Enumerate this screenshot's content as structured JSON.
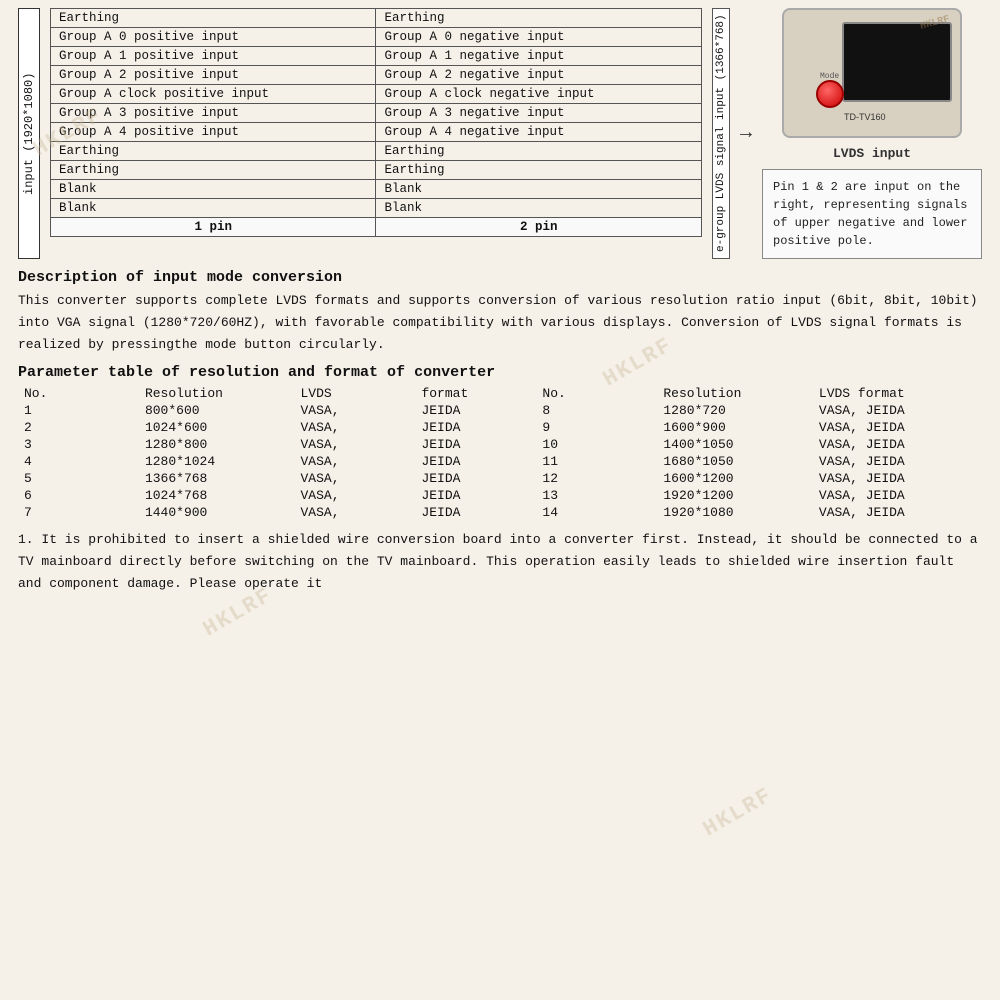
{
  "watermarks": [
    "HKLRF",
    "HKLRF",
    "HKLRF",
    "HKLRF"
  ],
  "left_label": "input (1920*1080)",
  "lvds_signal_label": "e-group LVDS signal input (1366*768)",
  "pin_table": {
    "columns": [
      "1 pin",
      "2 pin"
    ],
    "rows": [
      [
        "Earthing",
        "Earthing"
      ],
      [
        "Group A 0 positive input",
        "Group A 0 negative input"
      ],
      [
        "Group A 1 positive input",
        "Group A 1 negative input"
      ],
      [
        "Group A 2 positive input",
        "Group A 2 negative input"
      ],
      [
        "Group A clock positive input",
        "Group A clock negative input"
      ],
      [
        "Group A 3 positive input",
        "Group A 3 negative input"
      ],
      [
        "Group A 4 positive input",
        "Group A 4 negative input"
      ],
      [
        "Earthing",
        "Earthing"
      ],
      [
        "Earthing",
        "Earthing"
      ],
      [
        "Blank",
        "Blank"
      ],
      [
        "Blank",
        "Blank"
      ]
    ],
    "footer": [
      "1 pin",
      "2 pin"
    ]
  },
  "device": {
    "brand": "HKLRF",
    "model": "TD-TV160",
    "mode_text": "Mode"
  },
  "lvds_input_label": "LVDS input",
  "note_box": "Pin 1 & 2 are input on the right, representing signals of upper negative and lower positive pole.",
  "description": {
    "title": "Description of input mode conversion",
    "body": "This converter supports complete LVDS formats and supports conversion of various resolution ratio input (6bit, 8bit, 10bit) into VGA signal (1280*720/60HZ), with favorable compatibility with various displays. Conversion of LVDS signal formats is realized by pressingthe mode button circularly."
  },
  "parameter": {
    "title": "Parameter table of resolution and format of converter",
    "header": [
      "No.",
      "Resolution",
      "LVDS",
      "format",
      "No.",
      "Resolution",
      "LVDS format"
    ],
    "rows": [
      [
        "1",
        "800*600",
        "VASA,",
        "JEIDA",
        "8",
        "1280*720",
        "VASA,  JEIDA"
      ],
      [
        "2",
        "1024*600",
        "VASA,",
        "JEIDA",
        "9",
        "1600*900",
        "VASA,  JEIDA"
      ],
      [
        "3",
        "1280*800",
        "VASA,",
        "JEIDA",
        "10",
        "1400*1050",
        "VASA,  JEIDA"
      ],
      [
        "4",
        "1280*1024",
        "VASA,",
        "JEIDA",
        "11",
        "1680*1050",
        "VASA,  JEIDA"
      ],
      [
        "5",
        "1366*768",
        "VASA,",
        "JEIDA",
        "12",
        "1600*1200",
        "VASA,  JEIDA"
      ],
      [
        "6",
        "1024*768",
        "VASA,",
        "JEIDA",
        "13",
        "1920*1200",
        "VASA,  JEIDA"
      ],
      [
        "7",
        "1440*900",
        "VASA,",
        "JEIDA",
        "14",
        "1920*1080",
        "VASA,  JEIDA"
      ]
    ]
  },
  "notes": {
    "text": "1.  It is prohibited to insert a shielded wire conversion board into a converter first.  Instead, it should be connected to a TV mainboard directly before switching on the TV mainboard.  This operation easily leads to shielded wire insertion fault and component damage.  Please operate it"
  }
}
